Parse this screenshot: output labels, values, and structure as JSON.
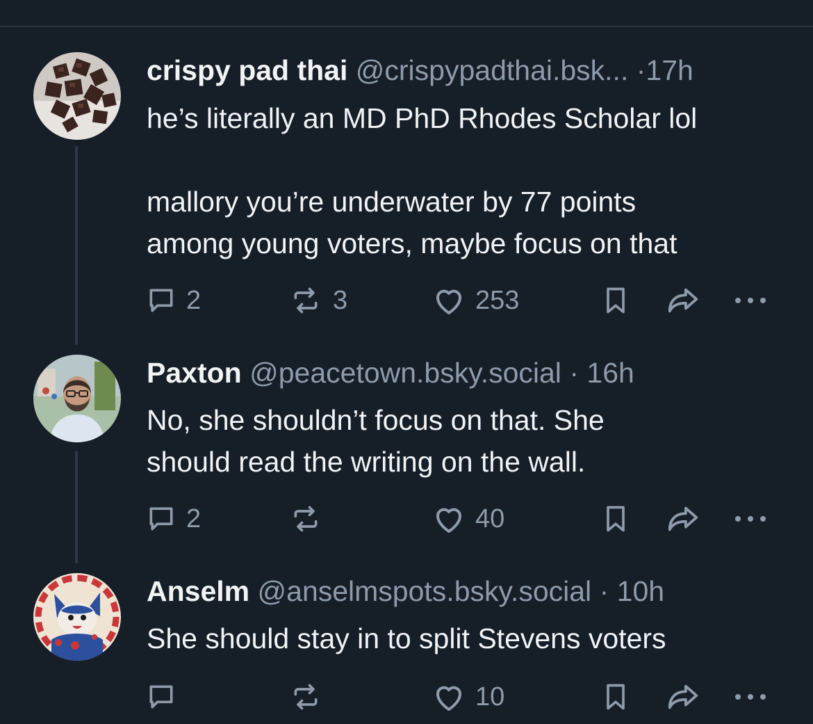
{
  "posts": [
    {
      "name": "crispy pad thai",
      "handle": "@crispypadthai.bsk...",
      "separator": "·",
      "time": "17h",
      "text": "he’s literally an MD PhD Rhodes Scholar lol\n\nmallory you’re underwater by 77 points\namong young voters, maybe focus on that",
      "reply_count": "2",
      "repost_count": "3",
      "like_count": "253",
      "avatar_icon": "chocolate-pieces-avatar"
    },
    {
      "name": "Paxton",
      "handle": "@peacetown.bsky.social",
      "separator": "·",
      "time": "16h",
      "text": "No, she shouldn’t focus on that. She\nshould read the writing on the wall.",
      "reply_count": "2",
      "repost_count": "",
      "like_count": "40",
      "avatar_icon": "bearded-man-avatar"
    },
    {
      "name": "Anselm",
      "handle": "@anselmspots.bsky.social",
      "separator": "·",
      "time": "10h",
      "text": "She should stay in to split Stevens voters",
      "reply_count": "",
      "repost_count": "",
      "like_count": "10",
      "avatar_icon": "cartoon-dog-avatar"
    }
  ],
  "icons": {
    "reply": "reply-bubble-icon",
    "repost": "repost-arrows-icon",
    "like": "heart-icon",
    "bookmark": "bookmark-icon",
    "share": "share-arrow-icon",
    "more": "ellipsis-icon"
  },
  "colors": {
    "background": "#161e27",
    "text": "#f1f3f5",
    "muted": "#8d9bab",
    "thread_line": "#2e3a48"
  }
}
